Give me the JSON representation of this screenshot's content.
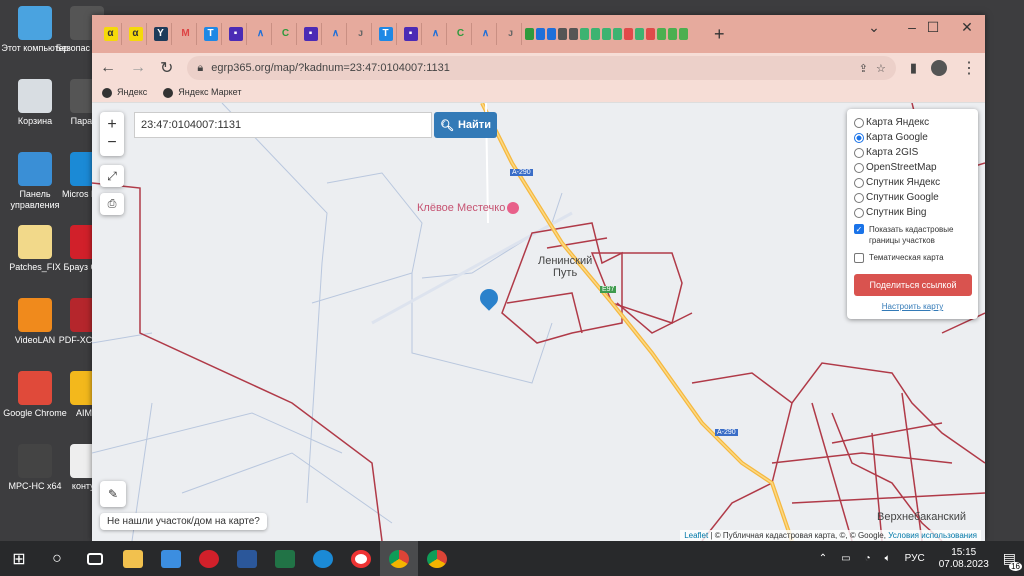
{
  "desktop": {
    "icons": [
      {
        "label": "Этот компьютер",
        "color": "#4aa3e0"
      },
      {
        "label": "Корзина",
        "color": "#d8dde2"
      },
      {
        "label": "Панель управления",
        "color": "#3a8fd6"
      },
      {
        "label": "Patches_FIX",
        "color": "#f2d98a"
      },
      {
        "label": "VideoLAN",
        "color": "#f08a1c"
      },
      {
        "label": "Google Chrome",
        "color": "#e04a3a"
      },
      {
        "label": "MPC-HC x64",
        "color": "#444"
      }
    ],
    "icons2": [
      {
        "label": "Безопас Windo",
        "color": "#555"
      },
      {
        "label": "Параме",
        "color": "#555"
      },
      {
        "label": "Micros Edge",
        "color": "#1b8ad6"
      },
      {
        "label": "Брауз Oper",
        "color": "#d1202a"
      },
      {
        "label": "PDF-XC Edito",
        "color": "#b5262c"
      },
      {
        "label": "AIMP",
        "color": "#f3b81c"
      },
      {
        "label": "контур.",
        "color": "#eee"
      }
    ]
  },
  "browser": {
    "window_controls": {
      "dropdown": "⌄",
      "minimize": "–",
      "maximize": "☐",
      "close": "✕"
    },
    "new_tab": "+",
    "url": "egrp365.org/map/?kadnum=23:47:0104007:1131",
    "bookmarks": [
      "Яндекс",
      "Яндекс Маркет"
    ]
  },
  "map": {
    "zoom_in": "+",
    "zoom_out": "−",
    "search_value": "23:47:0104007:1131",
    "find_label": "Найти",
    "labels": {
      "poi": "Клёвое Местечко",
      "village1": "Ленинский",
      "village2": "Путь",
      "town": "Верхнебаканский",
      "road1": "А-290",
      "road2": "Е97",
      "road3": "А-290"
    },
    "layers": [
      {
        "label": "Карта Яндекс",
        "selected": false
      },
      {
        "label": "Карта Google",
        "selected": true
      },
      {
        "label": "Карта 2GIS",
        "selected": false
      },
      {
        "label": "OpenStreetMap",
        "selected": false
      },
      {
        "label": "Спутник Яндекс",
        "selected": false
      },
      {
        "label": "Спутник Google",
        "selected": false
      },
      {
        "label": "Спутник Bing",
        "selected": false
      }
    ],
    "show_cadastral": {
      "label": "Показать кадастровые границы участков",
      "checked": true
    },
    "thematic": {
      "label": "Тематическая карта",
      "checked": false
    },
    "share_label": "Поделиться ссылкой",
    "configure_label": "Настроить карту",
    "not_found_label": "Не нашли участок/дом на карте?",
    "attribution": {
      "leaflet": "Leaflet",
      "text": "© Публичная кадастровая карта, ©, © Google,",
      "terms": "Условия использования"
    }
  },
  "taskbar": {
    "lang": "РУС",
    "time": "15:15",
    "date": "07.08.2023",
    "notifications": "16"
  },
  "colors": {
    "titlebar": "#e6aa9d",
    "boundary": "#b03a48",
    "road": "#f5b840",
    "button": "#337ab7",
    "share": "#d9534f"
  }
}
